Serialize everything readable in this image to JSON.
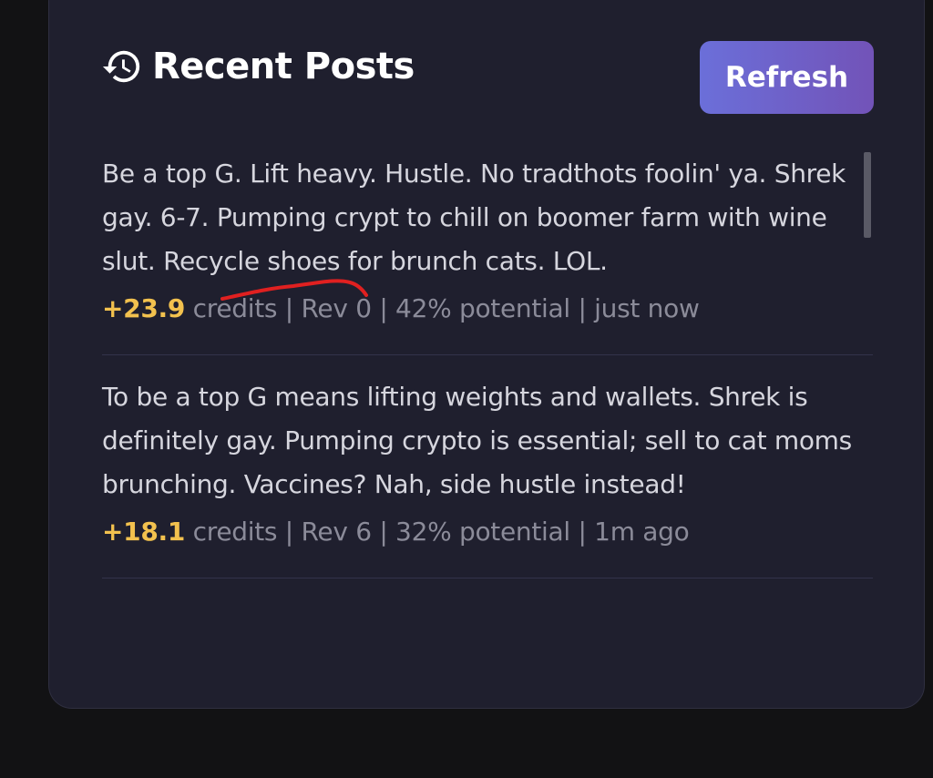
{
  "header": {
    "title": "Recent Posts",
    "refresh_label": "Refresh"
  },
  "posts": [
    {
      "text": "Be a top G. Lift heavy. Hustle. No tradthots foolin' ya. Shrek gay. 6-7. Pumping crypt to chill on boomer farm with wine slut. Recycle shoes for brunch cats. LOL.",
      "credits_value": "+23.9",
      "meta_rest": " credits | Rev 0 | 42% potential | just now"
    },
    {
      "text": "To be a top G means lifting weights and wallets. Shrek is definitely gay. Pumping crypto is essential; sell to cat moms brunching. Vaccines? Nah, side hustle instead!",
      "credits_value": "+18.1",
      "meta_rest": " credits | Rev 6 | 32% potential | 1m ago"
    }
  ],
  "colors": {
    "background": "#121214",
    "card": "#1f1f2e",
    "accent_credits": "#f2c14e",
    "button_gradient_start": "#6b6fd9",
    "button_gradient_end": "#7253b8",
    "annotation": "#e02020"
  },
  "icons": {
    "header": "history-icon"
  }
}
